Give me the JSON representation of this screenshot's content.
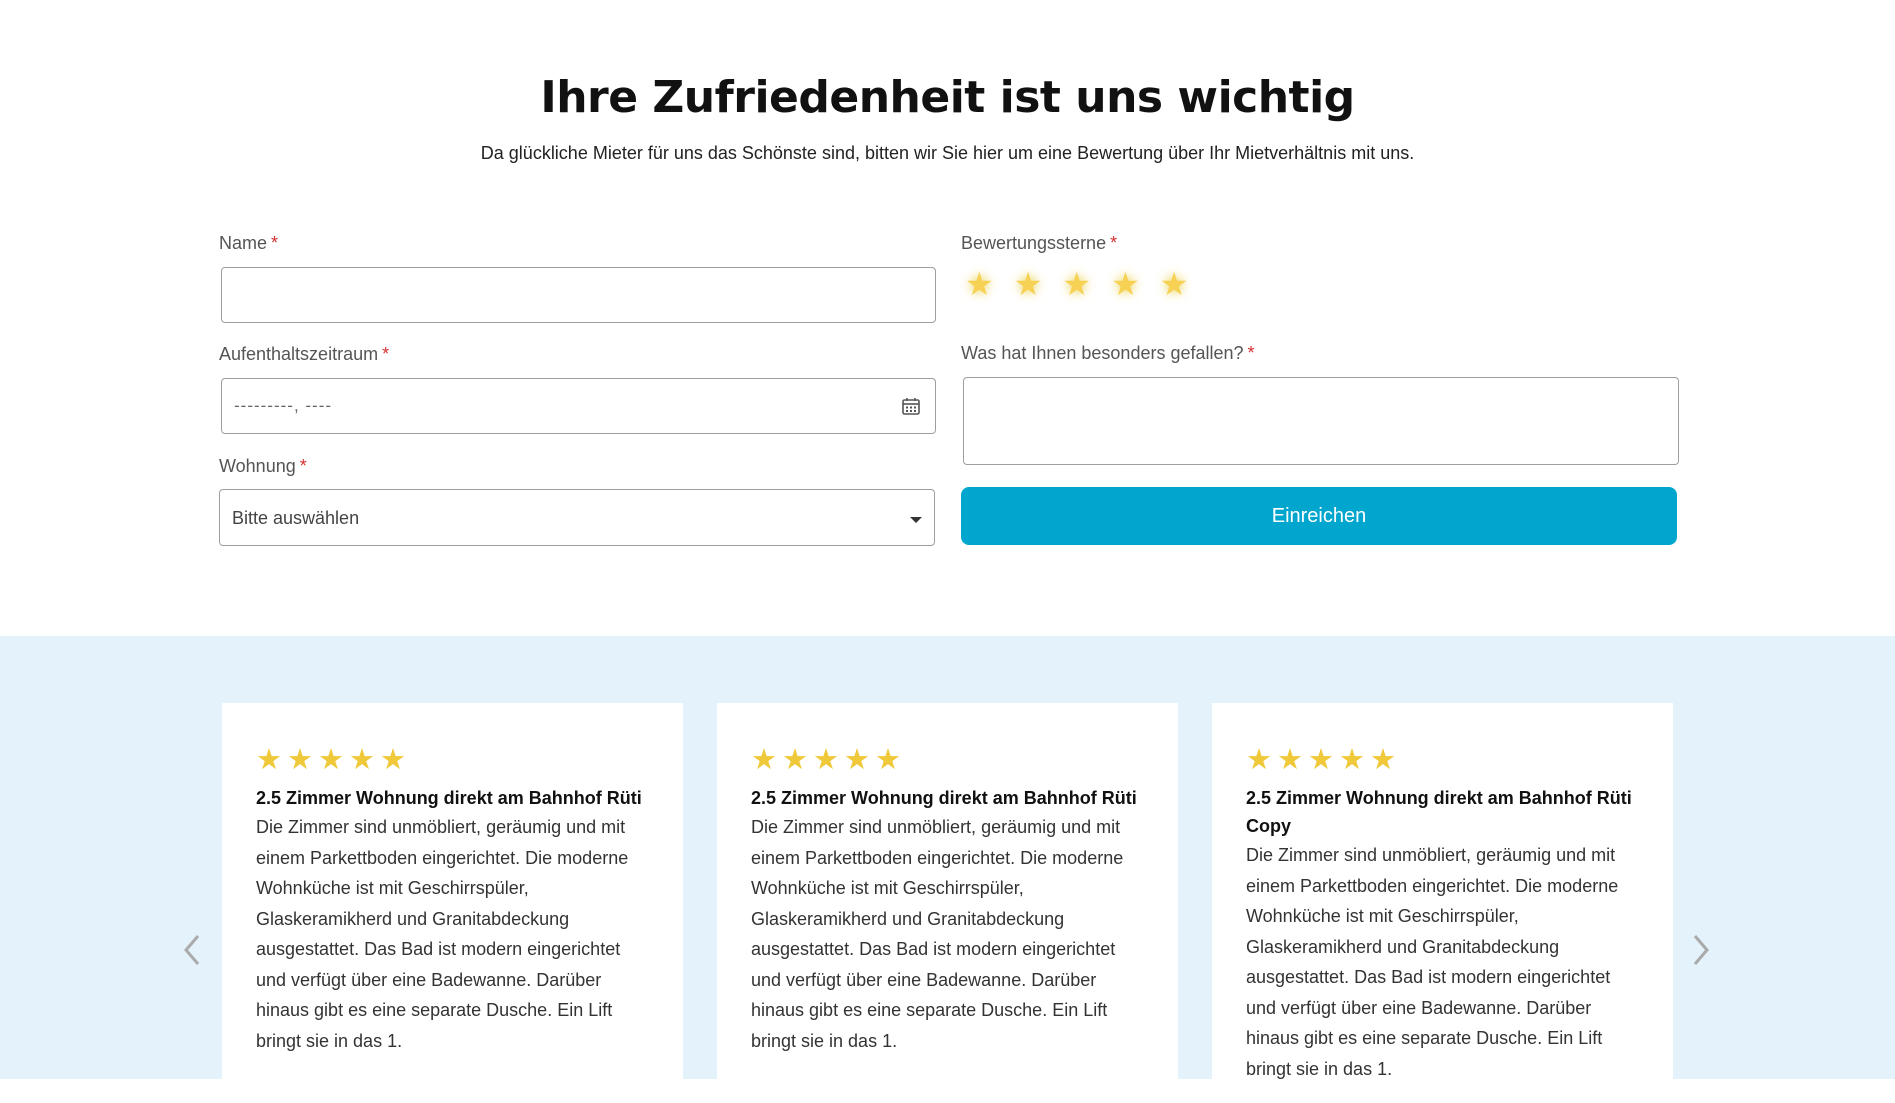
{
  "header": {
    "title": "Ihre Zufriedenheit ist uns wichtig",
    "subtitle": "Da glückliche Mieter für uns das Schönste sind, bitten wir Sie hier um eine Bewertung über Ihr Mietverhältnis mit uns."
  },
  "form": {
    "name": {
      "label": "Name",
      "required_mark": "*",
      "value": ""
    },
    "stay_period": {
      "label": "Aufenthaltszeitraum",
      "required_mark": "*",
      "placeholder": "---------, ----"
    },
    "apartment": {
      "label": "Wohnung",
      "required_mark": "*",
      "selected": "Bitte auswählen"
    },
    "rating": {
      "label": "Bewertungssterne",
      "required_mark": "*",
      "max_stars": 5,
      "star_glyph": "★"
    },
    "liked": {
      "label": "Was hat Ihnen besonders gefallen?",
      "required_mark": "*",
      "value": ""
    },
    "submit_label": "Einreichen"
  },
  "reviews": [
    {
      "stars": [
        "★",
        "★",
        "★",
        "★",
        "★"
      ],
      "title": "2.5 Zimmer Wohnung direkt am Bahnhof Rüti",
      "text_lines": [
        "Die Zimmer sind unmöbliert, geräumig und mit",
        "einem Parkettboden eingerichtet. Die moderne",
        "Wohnküche ist mit Geschirrspüler,",
        "Glaskeramikherd und Granitabdeckung",
        "ausgestattet. Das Bad ist modern eingerichtet",
        "und verfügt über eine Badewanne. Darüber",
        "hinaus gibt es eine separate Dusche. Ein Lift",
        "bringt sie in das 1."
      ]
    },
    {
      "stars": [
        "★",
        "★",
        "★",
        "★",
        "★"
      ],
      "title": "2.5 Zimmer Wohnung direkt am Bahnhof Rüti",
      "text_lines": [
        "Die Zimmer sind unmöbliert, geräumig und mit",
        "einem Parkettboden eingerichtet. Die moderne",
        "Wohnküche ist mit Geschirrspüler,",
        "Glaskeramikherd und Granitabdeckung",
        "ausgestattet. Das Bad ist modern eingerichtet",
        "und verfügt über eine Badewanne. Darüber",
        "hinaus gibt es eine separate Dusche. Ein Lift",
        "bringt sie in das 1."
      ]
    },
    {
      "stars": [
        "★",
        "★",
        "★",
        "★",
        "★"
      ],
      "title": "2.5 Zimmer Wohnung direkt am Bahnhof Rüti Copy",
      "text_lines": [
        "Die Zimmer sind unmöbliert, geräumig und mit",
        "einem Parkettboden eingerichtet. Die moderne",
        "Wohnküche ist mit Geschirrspüler,",
        "Glaskeramikherd und Granitabdeckung",
        "ausgestattet. Das Bad ist modern eingerichtet",
        "und verfügt über eine Badewanne. Darüber",
        "hinaus gibt es eine separate Dusche. Ein Lift",
        "bringt sie in das 1."
      ]
    }
  ],
  "carousel": {
    "prev_icon": "chevron-left-icon",
    "next_icon": "chevron-right-icon"
  },
  "colors": {
    "accent": "#00a6ce",
    "star": "#f0c93b",
    "required": "#d32f2f",
    "reviews_background": "#e4f3fb"
  }
}
